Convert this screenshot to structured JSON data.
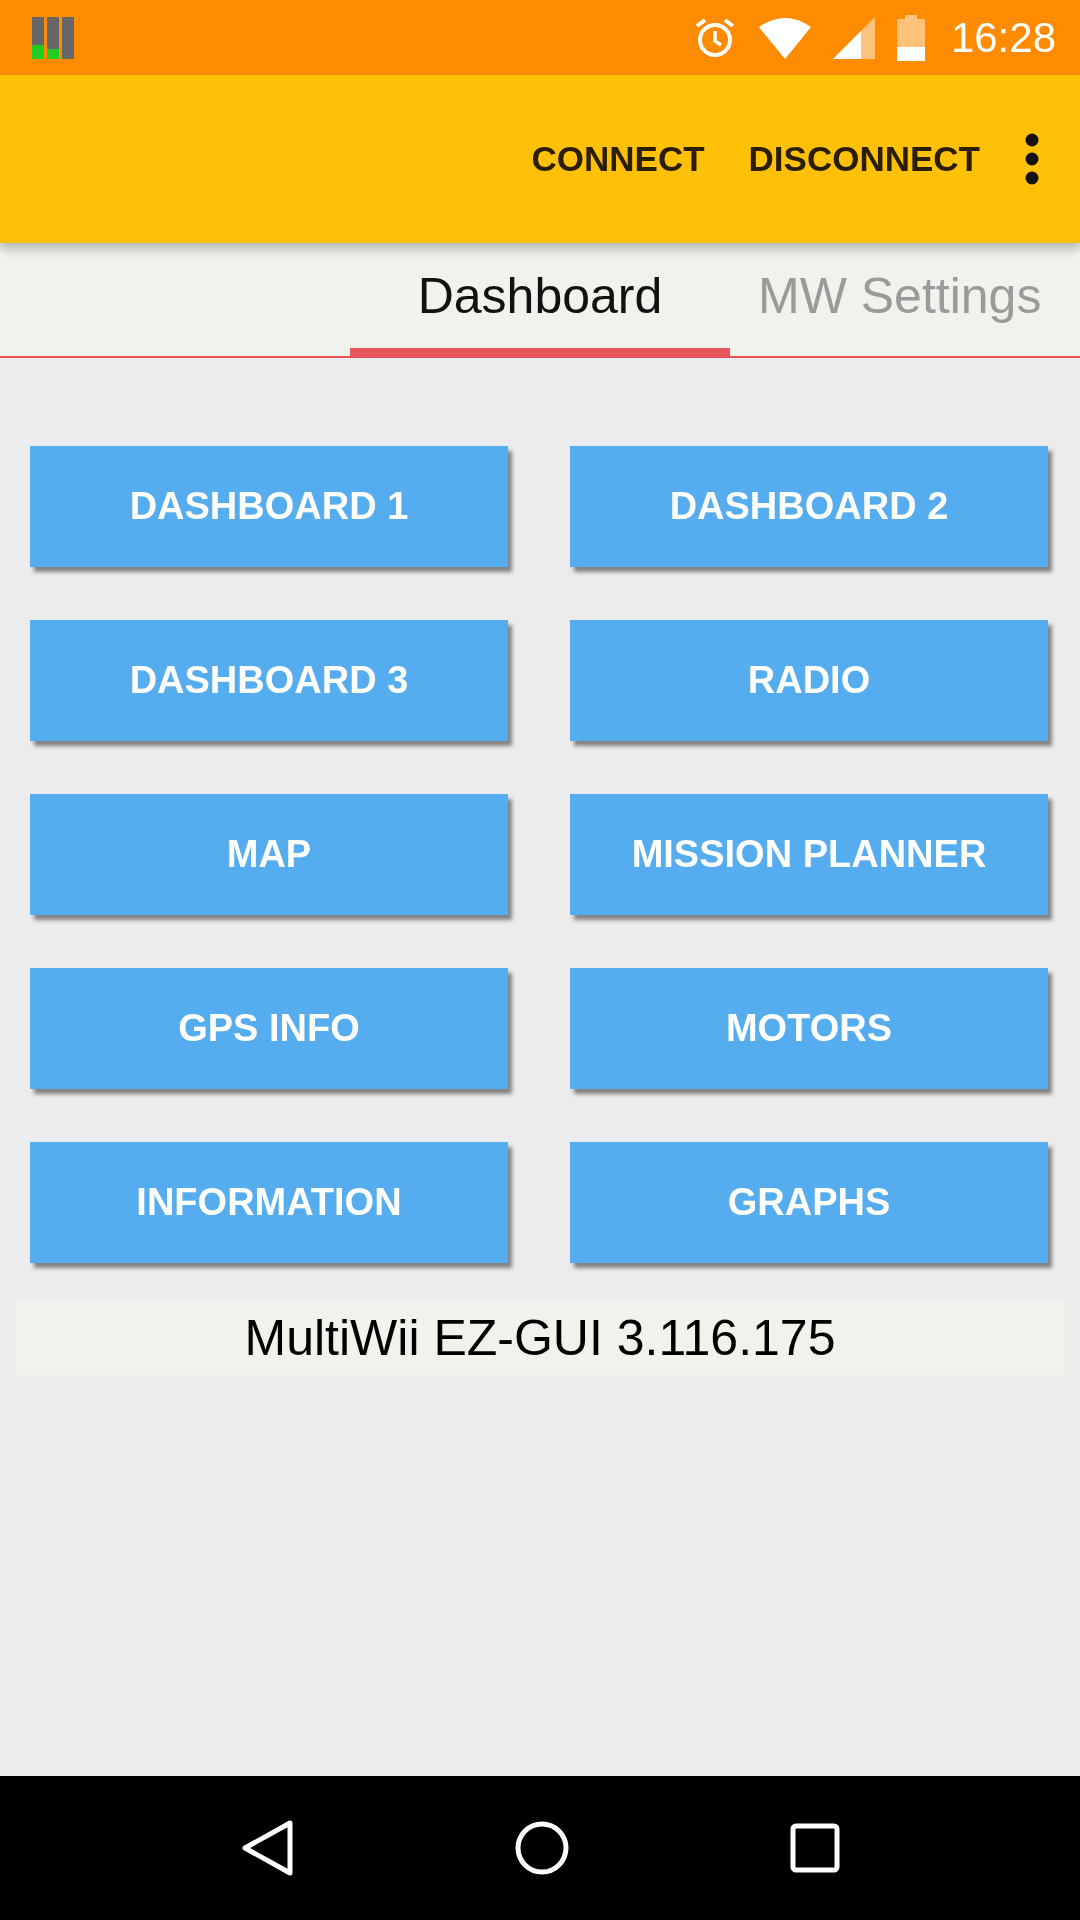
{
  "status_bar": {
    "time": "16:28"
  },
  "app_bar": {
    "actions": [
      "CONNECT",
      "DISCONNECT"
    ]
  },
  "tabs": [
    {
      "label": "Dashboard",
      "selected": true
    },
    {
      "label": "MW Settings",
      "selected": false
    }
  ],
  "buttons": [
    "DASHBOARD 1",
    "DASHBOARD 2",
    "DASHBOARD 3",
    "RADIO",
    "MAP",
    "MISSION PLANNER",
    "GPS INFO",
    "MOTORS",
    "INFORMATION",
    "GRAPHS"
  ],
  "version": "MultiWii EZ-GUI 3.116.175"
}
